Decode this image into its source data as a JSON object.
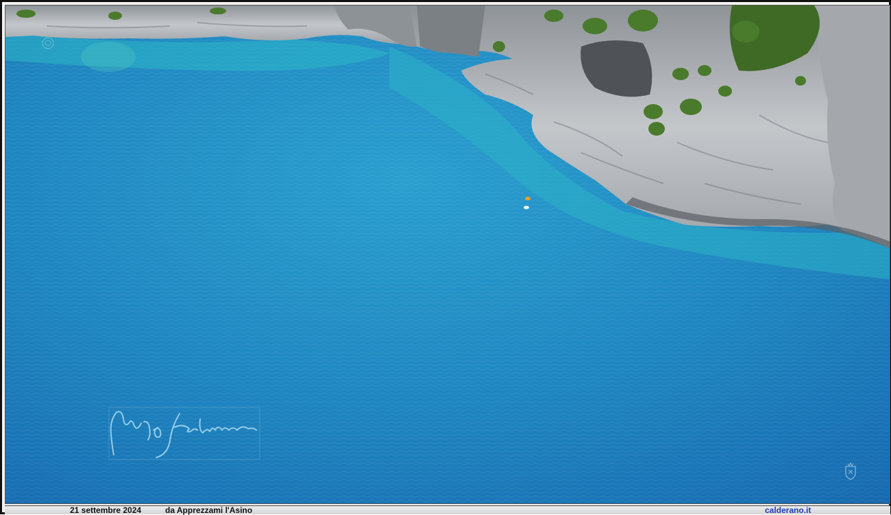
{
  "photo": {
    "subject": "",
    "colors": {
      "sea_deep": "#1a6fb5",
      "sea_mid": "#1f8cc4",
      "sea_shallow": "#2fb7c8",
      "rock": "#b9bcc0",
      "rock_shadow": "#6f7378",
      "vegetation": "#4a7a2c",
      "signature_ink": "#9ad0ee"
    },
    "signature": "Carmine Calderano",
    "kayaks": 2
  },
  "caption": {
    "date": "21 settembre 2024",
    "source": "da Apprezzami l'Asino",
    "site": "calderano.it"
  }
}
